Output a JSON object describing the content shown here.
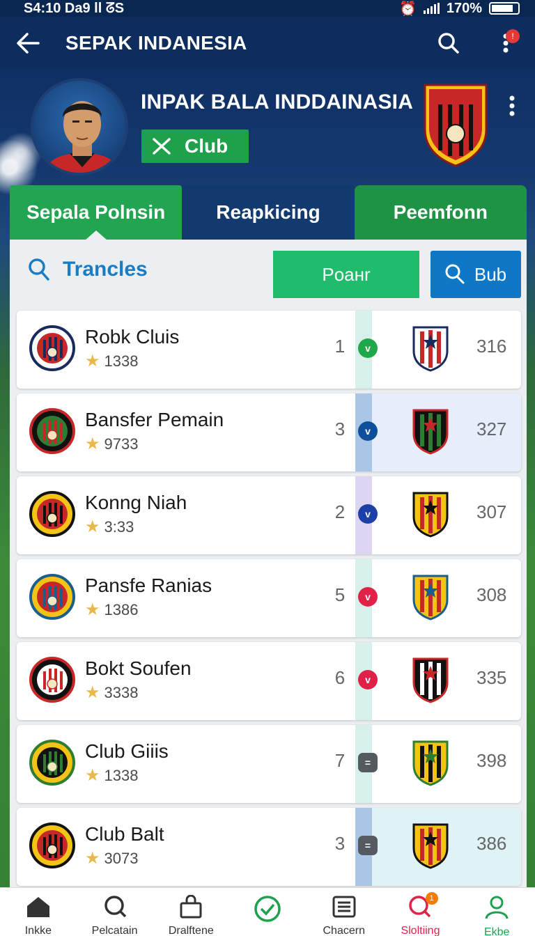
{
  "status_bar": {
    "time": "S4:10  Da9 ll ᘔS",
    "battery": "170%"
  },
  "app_bar": {
    "title": "SEPAK INDANESIA",
    "notification_badge": "!"
  },
  "header": {
    "club_name": "INPAK BALA INDDAINASIA",
    "chip_label": "Club"
  },
  "tabs": [
    {
      "label": "Sepala Polnsin"
    },
    {
      "label": "Reapkicing"
    },
    {
      "label": "Peemfonn"
    }
  ],
  "toolbar": {
    "search_label": "Trancles",
    "green_button": "Poанr",
    "blue_button": "Bub"
  },
  "rows": [
    {
      "name": "Robk Cluis",
      "sub": "1338",
      "rank": "1",
      "score": "316",
      "dot_color": "#20a84a",
      "dot": "v",
      "stripe": "#d7f1ea",
      "crest_colors": [
        "#1a2a5c",
        "#ffffff",
        "#c62828"
      ]
    },
    {
      "name": "Bansfer Pemain",
      "sub": "9733",
      "rank": "3",
      "score": "327",
      "dot_color": "#0e4f9b",
      "dot": "v",
      "stripe": "#a9c6e6",
      "crest_colors": [
        "#c62828",
        "#111111",
        "#2e7d32"
      ]
    },
    {
      "name": "Konng Niah",
      "sub": "3:33",
      "rank": "2",
      "score": "307",
      "dot_color": "#1c3fa8",
      "dot": "v",
      "stripe": "#ddd6f3",
      "crest_colors": [
        "#111111",
        "#f3c316",
        "#c62828"
      ]
    },
    {
      "name": "Pansfe Ranias",
      "sub": "1386",
      "rank": "5",
      "score": "308",
      "dot_color": "#e0224a",
      "dot": "v",
      "stripe": "#d7f1ea",
      "crest_colors": [
        "#1a5e8c",
        "#f3c316",
        "#c62828"
      ]
    },
    {
      "name": "Bokt Soufen",
      "sub": "3338",
      "rank": "6",
      "score": "335",
      "dot_color": "#e0224a",
      "dot": "v",
      "stripe": "#d7f1ea",
      "crest_colors": [
        "#c62828",
        "#111111",
        "#ffffff"
      ]
    },
    {
      "name": "Club Giiis",
      "sub": "1338",
      "rank": "7",
      "score": "398",
      "dot_color": "#555a60",
      "dot": "=",
      "stripe": "#d7f1ea",
      "crest_colors": [
        "#2e7d32",
        "#f3c316",
        "#111111"
      ]
    },
    {
      "name": "Club Balt",
      "sub": "3073",
      "rank": "3",
      "score": "386",
      "dot_color": "#555a60",
      "dot": "=",
      "stripe": "#a9c6e6",
      "crest_colors": [
        "#111111",
        "#f3c316",
        "#c62828"
      ]
    }
  ],
  "bottom_nav": [
    {
      "label": "Inkke",
      "icon": "home-icon"
    },
    {
      "label": "Pelcatain",
      "icon": "search-icon"
    },
    {
      "label": "Dralftene",
      "icon": "bag-icon"
    },
    {
      "label": "",
      "icon": "check-circle-icon"
    },
    {
      "label": "Chacern",
      "icon": "list-icon"
    },
    {
      "label": "Sloltiing",
      "icon": "search-alert-icon",
      "badge": "1"
    },
    {
      "label": "Ekbe",
      "icon": "person-icon"
    }
  ],
  "colors": {
    "primary_navy": "#0d2d5e",
    "accent_green": "#22a550",
    "accent_blue": "#0e78c7",
    "link_blue": "#1a7cc4"
  }
}
